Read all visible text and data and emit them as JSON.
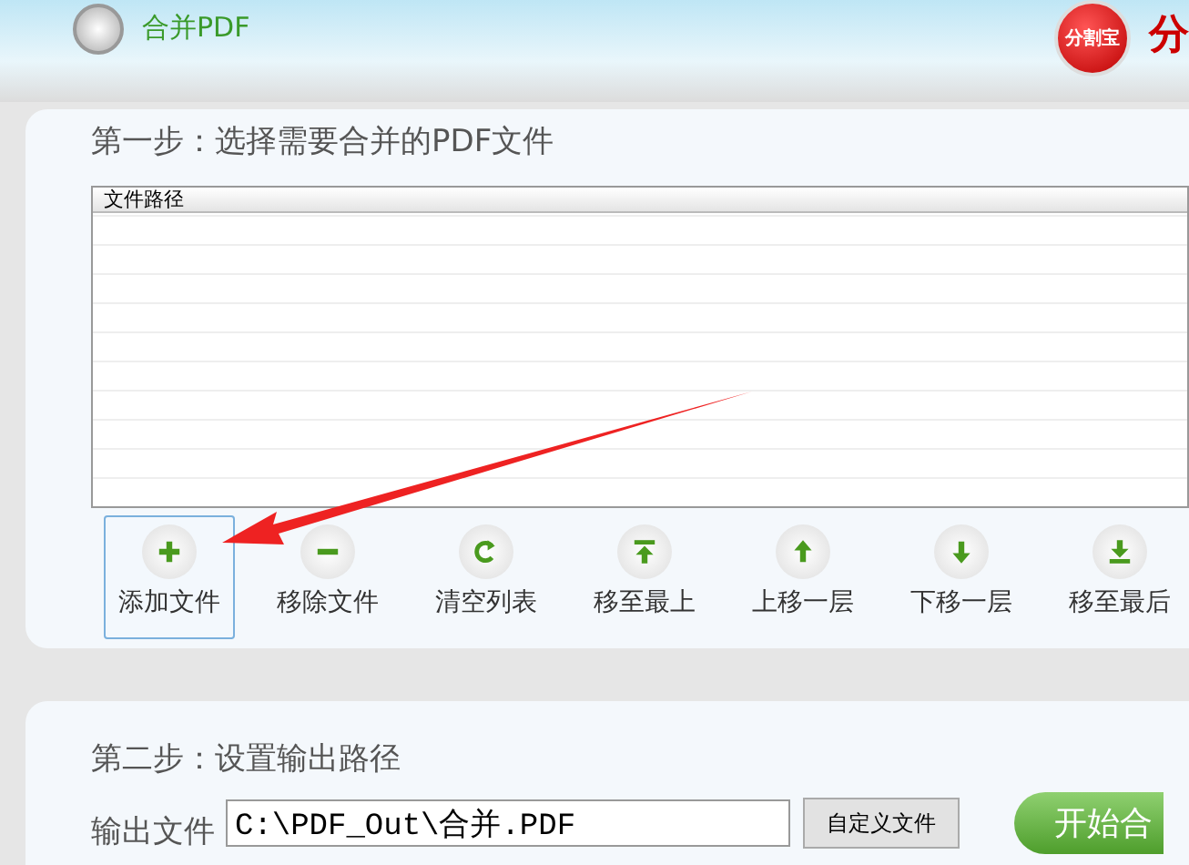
{
  "header": {
    "title": "合并PDF",
    "logo_text": "分割宝",
    "brand_char": "分"
  },
  "step1": {
    "title": "第一步：选择需要合并的PDF文件",
    "file_list": {
      "columns": [
        "文件路径"
      ]
    },
    "buttons": [
      {
        "label": "添加文件",
        "kind": "add",
        "selected": true
      },
      {
        "label": "移除文件",
        "kind": "remove",
        "selected": false
      },
      {
        "label": "清空列表",
        "kind": "clear",
        "selected": false
      },
      {
        "label": "移至最上",
        "kind": "top",
        "selected": false
      },
      {
        "label": "上移一层",
        "kind": "up",
        "selected": false
      },
      {
        "label": "下移一层",
        "kind": "down",
        "selected": false
      },
      {
        "label": "移至最后",
        "kind": "bottom",
        "selected": false
      }
    ]
  },
  "step2": {
    "title": "第二步：设置输出路径",
    "output_label": "输出文件",
    "output_value": "C:\\PDF_Out\\合并.PDF",
    "custom_button": "自定义文件",
    "start_button": "开始合"
  }
}
